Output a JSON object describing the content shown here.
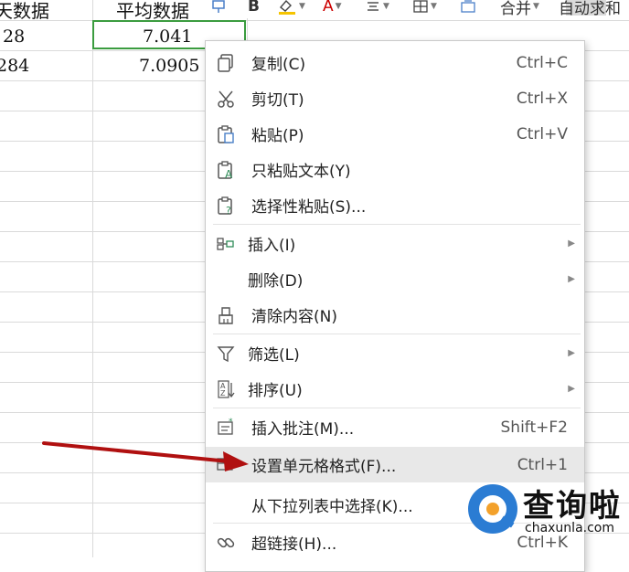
{
  "sheet": {
    "header_col1": "天数据",
    "header_col2": "平均数据",
    "row1_col1": "28",
    "row1_col2": "7.041",
    "row2_col1": "284",
    "row2_col2": "7.0905"
  },
  "toolbar": {
    "bold": "B",
    "font_color": "A",
    "merge": "合并",
    "autosum": "自动求和"
  },
  "menu": {
    "items": [
      {
        "label": "复制(C)",
        "shortcut": "Ctrl+C"
      },
      {
        "label": "剪切(T)",
        "shortcut": "Ctrl+X"
      },
      {
        "label": "粘贴(P)",
        "shortcut": "Ctrl+V"
      },
      {
        "label": "只粘贴文本(Y)",
        "shortcut": ""
      },
      {
        "label": "选择性粘贴(S)...",
        "shortcut": ""
      },
      {
        "label": "插入(I)",
        "shortcut": ""
      },
      {
        "label": "删除(D)",
        "shortcut": ""
      },
      {
        "label": "清除内容(N)",
        "shortcut": ""
      },
      {
        "label": "筛选(L)",
        "shortcut": ""
      },
      {
        "label": "排序(U)",
        "shortcut": ""
      },
      {
        "label": "插入批注(M)...",
        "shortcut": "Shift+F2"
      },
      {
        "label": "设置单元格格式(F)...",
        "shortcut": "Ctrl+1"
      },
      {
        "label": "从下拉列表中选择(K)...",
        "shortcut": ""
      },
      {
        "label": "超链接(H)...",
        "shortcut": "Ctrl+K"
      }
    ]
  },
  "watermark": {
    "title": "查询啦",
    "url": "chaxunla.com"
  },
  "colors": {
    "selection": "#3b9c3f",
    "arrow": "#b01010",
    "highlight": "#e8e8e8"
  }
}
